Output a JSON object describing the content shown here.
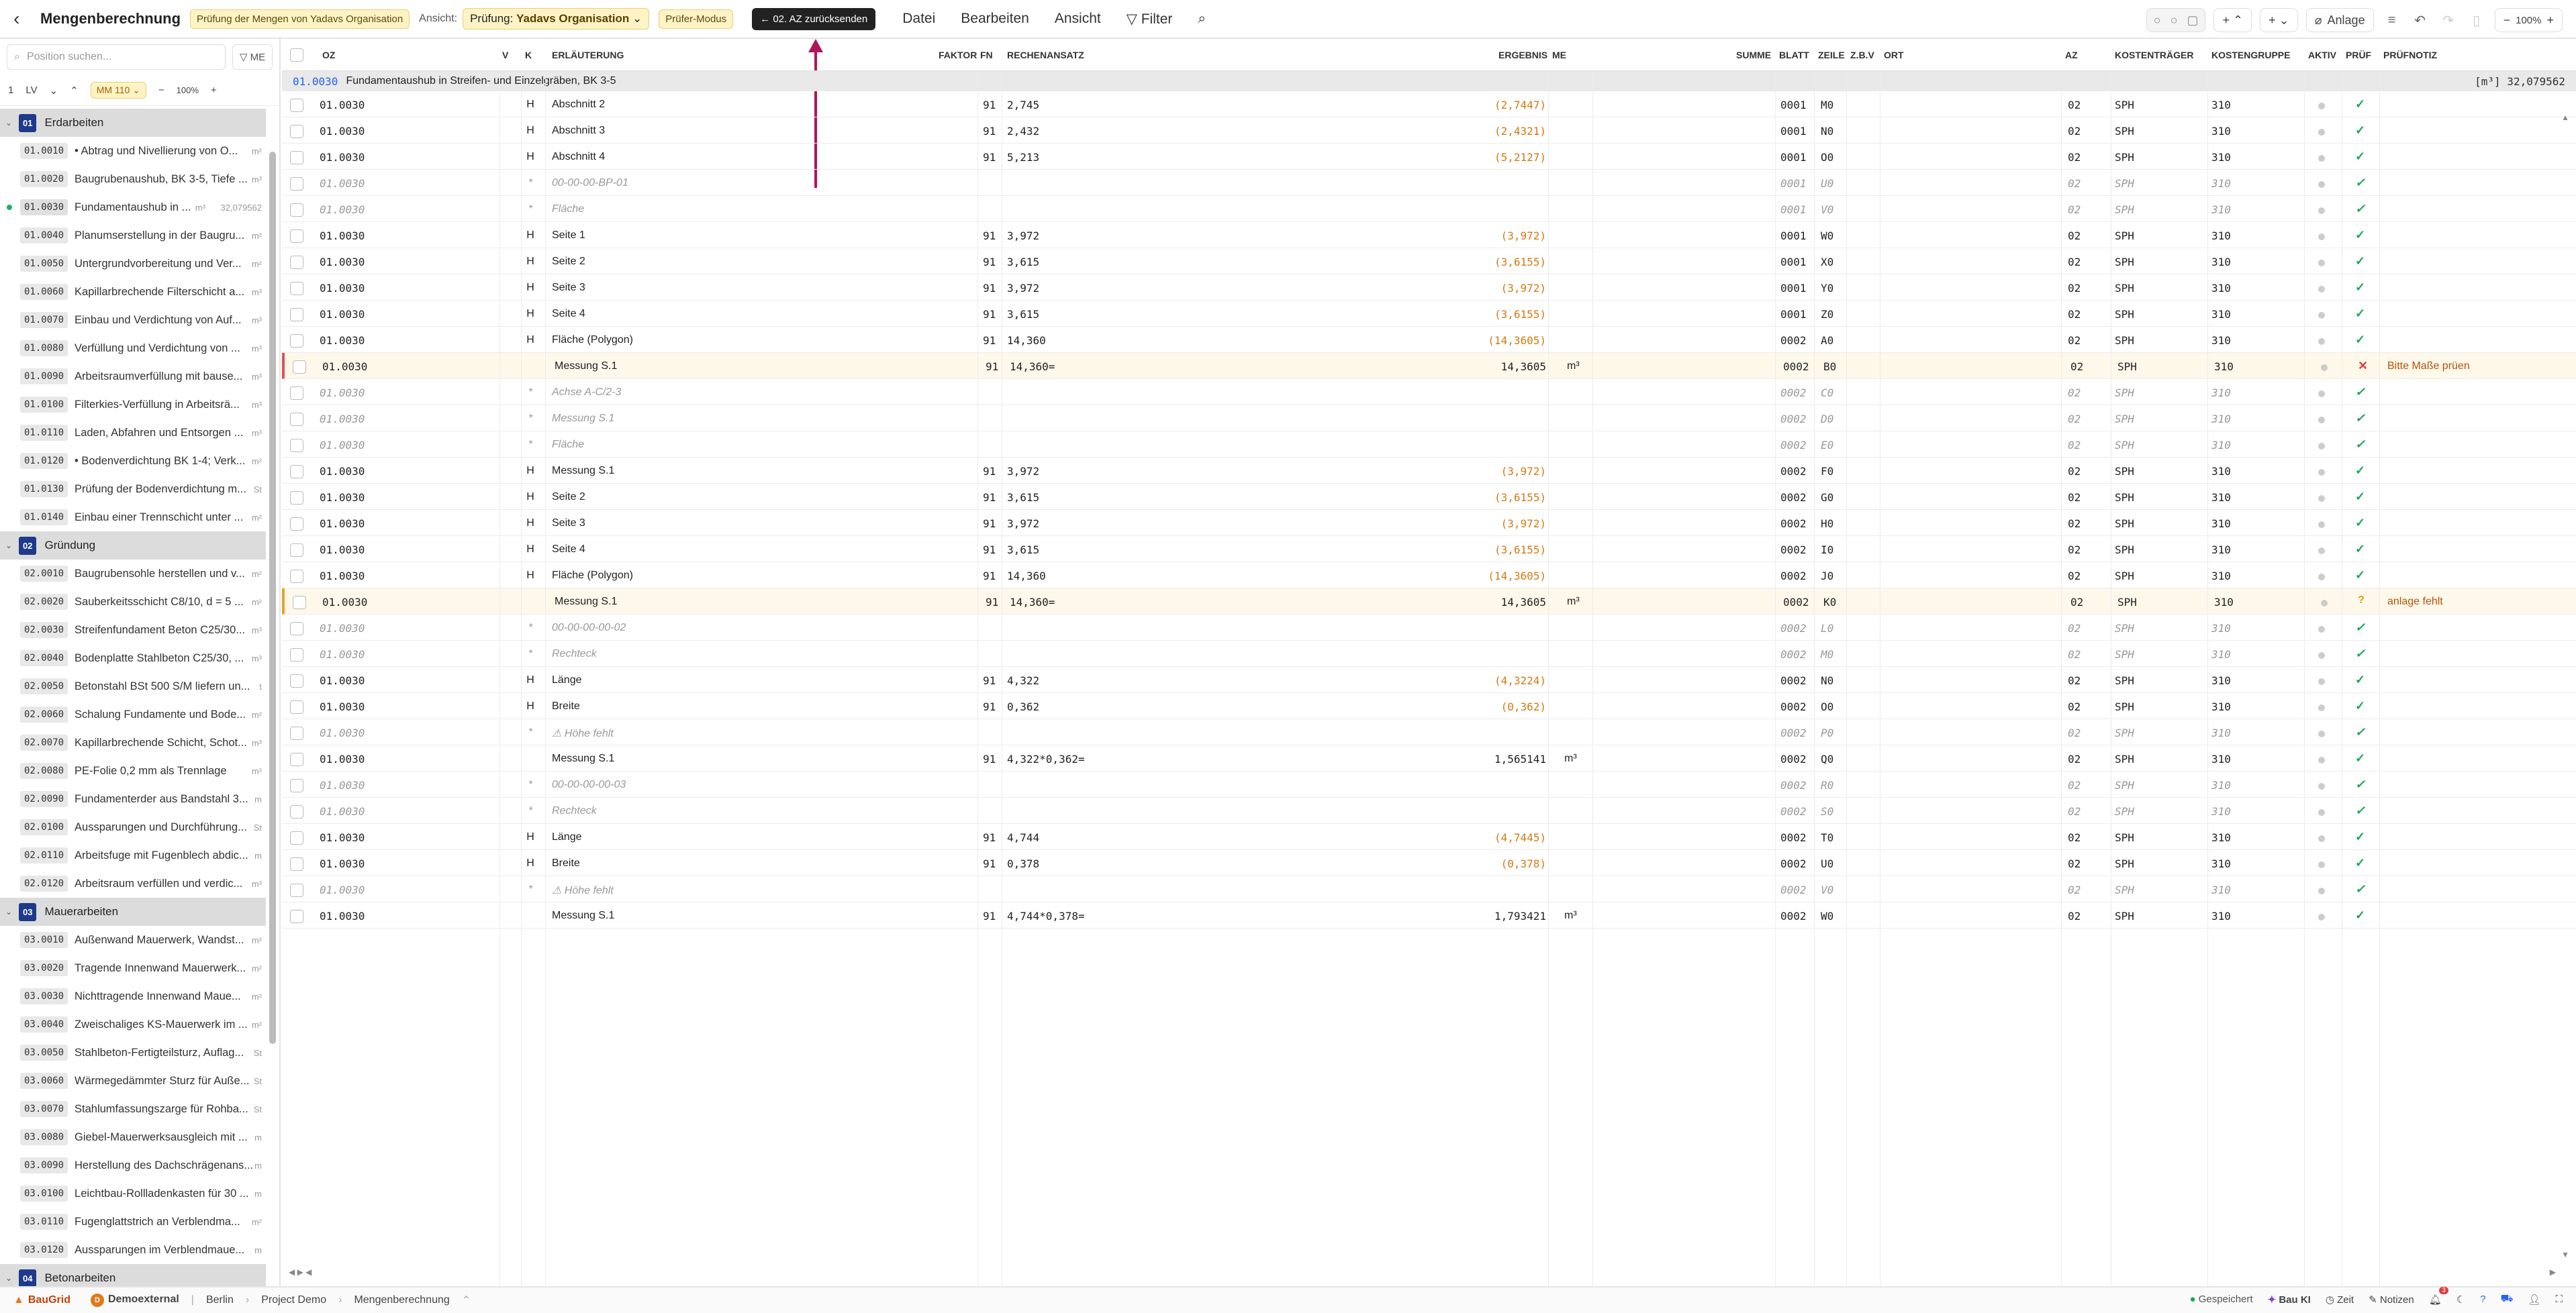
{
  "topbar": {
    "title": "Mengenberechnung",
    "review_badge": "Prüfung der Mengen von Yadavs Organisation",
    "view_label": "Ansicht:",
    "view_prefix": "Prüfung:",
    "view_value": "Yadavs Organisation",
    "mode_badge": "Prüfer-Modus",
    "send_back_button": "02. AZ zurücksenden",
    "menu": [
      "Datei",
      "Bearbeiten",
      "Ansicht"
    ],
    "filter": "Filter",
    "attachment": "Anlage",
    "zoom": "100%"
  },
  "sidebar": {
    "search_placeholder": "Position suchen...",
    "me_button": "ME",
    "level": "1",
    "lv": "LV",
    "mm_badge": "MM 110",
    "zoom": "100%",
    "groups": [
      {
        "num": "01",
        "title": "Erdarbeiten",
        "items": [
          {
            "oz": "01.0010",
            "text": "• Abtrag und Nivellierung von O...",
            "unit": "m²"
          },
          {
            "oz": "01.0020",
            "text": "Baugrubenaushub, BK 3-5, Tiefe ...",
            "unit": "m³"
          },
          {
            "oz": "01.0030",
            "text": "Fundamentaushub in ...",
            "unit": "m³",
            "sum": "32,079562",
            "active": true
          },
          {
            "oz": "01.0040",
            "text": "Planumserstellung in der Baugru...",
            "unit": "m²"
          },
          {
            "oz": "01.0050",
            "text": "Untergrundvorbereitung und Ver...",
            "unit": "m²"
          },
          {
            "oz": "01.0060",
            "text": "Kapillarbrechende Filterschicht a...",
            "unit": "m³"
          },
          {
            "oz": "01.0070",
            "text": "Einbau und Verdichtung von Auf...",
            "unit": "m³"
          },
          {
            "oz": "01.0080",
            "text": "Verfüllung und Verdichtung von ...",
            "unit": "m³"
          },
          {
            "oz": "01.0090",
            "text": "Arbeitsraumverfüllung mit bause...",
            "unit": "m³"
          },
          {
            "oz": "01.0100",
            "text": "Filterkies-Verfüllung in Arbeitsrä...",
            "unit": "m³"
          },
          {
            "oz": "01.0110",
            "text": "Laden, Abfahren und Entsorgen ...",
            "unit": "m³"
          },
          {
            "oz": "01.0120",
            "text": "• Bodenverdichtung BK 1-4; Verk...",
            "unit": "m²"
          },
          {
            "oz": "01.0130",
            "text": "Prüfung der Bodenverdichtung m...",
            "unit": "St"
          },
          {
            "oz": "01.0140",
            "text": "Einbau einer Trennschicht unter ...",
            "unit": "m²"
          }
        ]
      },
      {
        "num": "02",
        "title": "Gründung",
        "items": [
          {
            "oz": "02.0010",
            "text": "Baugrubensohle herstellen und v...",
            "unit": "m²"
          },
          {
            "oz": "02.0020",
            "text": "Sauberkeitsschicht C8/10, d = 5 ...",
            "unit": "m²"
          },
          {
            "oz": "02.0030",
            "text": "Streifenfundament Beton C25/30...",
            "unit": "m³"
          },
          {
            "oz": "02.0040",
            "text": "Bodenplatte Stahlbeton C25/30, ...",
            "unit": "m³"
          },
          {
            "oz": "02.0050",
            "text": "Betonstahl BSt 500 S/M liefern un...",
            "unit": "t"
          },
          {
            "oz": "02.0060",
            "text": "Schalung Fundamente und Bode...",
            "unit": "m²"
          },
          {
            "oz": "02.0070",
            "text": "Kapillarbrechende Schicht, Schot...",
            "unit": "m³"
          },
          {
            "oz": "02.0080",
            "text": "PE-Folie 0,2 mm als Trennlage",
            "unit": "m²"
          },
          {
            "oz": "02.0090",
            "text": "Fundamenterder aus Bandstahl 3...",
            "unit": "m"
          },
          {
            "oz": "02.0100",
            "text": "Aussparungen und Durchführung...",
            "unit": "St"
          },
          {
            "oz": "02.0110",
            "text": "Arbeitsfuge mit Fugenblech abdic...",
            "unit": "m"
          },
          {
            "oz": "02.0120",
            "text": "Arbeitsraum verfüllen und verdic...",
            "unit": "m³"
          }
        ]
      },
      {
        "num": "03",
        "title": "Mauerarbeiten",
        "items": [
          {
            "oz": "03.0010",
            "text": "Außenwand Mauerwerk, Wandst...",
            "unit": "m²"
          },
          {
            "oz": "03.0020",
            "text": "Tragende Innenwand Mauerwerk...",
            "unit": "m²"
          },
          {
            "oz": "03.0030",
            "text": "Nichttragende Innenwand Maue...",
            "unit": "m²"
          },
          {
            "oz": "03.0040",
            "text": "Zweischaliges KS-Mauerwerk im ...",
            "unit": "m²"
          },
          {
            "oz": "03.0050",
            "text": "Stahlbeton-Fertigteilsturz, Auflag...",
            "unit": "St"
          },
          {
            "oz": "03.0060",
            "text": "Wärmegedämmter Sturz für Auße...",
            "unit": "St"
          },
          {
            "oz": "03.0070",
            "text": "Stahlumfassungszarge für Rohba...",
            "unit": "St"
          },
          {
            "oz": "03.0080",
            "text": "Giebel-Mauerwerksausgleich mit ...",
            "unit": "m"
          },
          {
            "oz": "03.0090",
            "text": "Herstellung des Dachschrägenans...",
            "unit": "m"
          },
          {
            "oz": "03.0100",
            "text": "Leichtbau-Rollladenkasten für 30 ...",
            "unit": "m"
          },
          {
            "oz": "03.0110",
            "text": "Fugenglattstrich an Verblendma...",
            "unit": "m²"
          },
          {
            "oz": "03.0120",
            "text": "Aussparungen im Verblendmaue...",
            "unit": "m"
          }
        ]
      },
      {
        "num": "04",
        "title": "Betonarbeiten",
        "items": []
      }
    ]
  },
  "grid": {
    "headers": {
      "oz": "OZ",
      "v": "V",
      "k": "K",
      "erl": "ERLÄUTERUNG",
      "faktor": "FAKTOR",
      "fn": "FN",
      "rechen": "RECHENANSATZ",
      "ergebnis": "ERGEBNIS",
      "me": "ME",
      "summe": "SUMME",
      "blatt": "BLATT",
      "zeile": "ZEILE",
      "zbv": "Z.B.V",
      "ort": "ORT",
      "az": "AZ",
      "kt": "KOSTENTRÄGER",
      "kg": "KOSTENGRUPPE",
      "aktiv": "AKTIV",
      "pruef": "PRÜF",
      "notiz": "PRÜFNOTIZ"
    },
    "section": {
      "oz": "01.0030",
      "title": "Fundamentaushub in Streifen- und Einzelgräben, BK 3-5",
      "sum": "[m³] 32,079562"
    },
    "rows": [
      {
        "oz": "01.0030",
        "k": "H",
        "erl": "Abschnitt 2",
        "fn": "91",
        "rechen": "2,745",
        "erg": "(2,7447)",
        "blatt": "0001",
        "zeile": "M0",
        "az": "02",
        "kt": "SPH",
        "kg": "310",
        "pruef": "check"
      },
      {
        "oz": "01.0030",
        "k": "H",
        "erl": "Abschnitt 3",
        "fn": "91",
        "rechen": "2,432",
        "erg": "(2,4321)",
        "blatt": "0001",
        "zeile": "N0",
        "az": "02",
        "kt": "SPH",
        "kg": "310",
        "pruef": "check"
      },
      {
        "oz": "01.0030",
        "k": "H",
        "erl": "Abschnitt 4",
        "fn": "91",
        "rechen": "5,213",
        "erg": "(5,2127)",
        "blatt": "0001",
        "zeile": "O0",
        "az": "02",
        "kt": "SPH",
        "kg": "310",
        "pruef": "check"
      },
      {
        "oz": "01.0030",
        "k": "*",
        "erl": "00-00-00-BP-01",
        "blatt": "0001",
        "zeile": "U0",
        "az": "02",
        "kt": "SPH",
        "kg": "310",
        "pruef": "check",
        "italic": true
      },
      {
        "oz": "01.0030",
        "k": "*",
        "erl": "Fläche",
        "blatt": "0001",
        "zeile": "V0",
        "az": "02",
        "kt": "SPH",
        "kg": "310",
        "pruef": "check",
        "italic": true
      },
      {
        "oz": "01.0030",
        "k": "H",
        "erl": "Seite 1",
        "fn": "91",
        "rechen": "3,972",
        "erg": "(3,972)",
        "blatt": "0001",
        "zeile": "W0",
        "az": "02",
        "kt": "SPH",
        "kg": "310",
        "pruef": "check"
      },
      {
        "oz": "01.0030",
        "k": "H",
        "erl": "Seite 2",
        "fn": "91",
        "rechen": "3,615",
        "erg": "(3,6155)",
        "blatt": "0001",
        "zeile": "X0",
        "az": "02",
        "kt": "SPH",
        "kg": "310",
        "pruef": "check"
      },
      {
        "oz": "01.0030",
        "k": "H",
        "erl": "Seite 3",
        "fn": "91",
        "rechen": "3,972",
        "erg": "(3,972)",
        "blatt": "0001",
        "zeile": "Y0",
        "az": "02",
        "kt": "SPH",
        "kg": "310",
        "pruef": "check"
      },
      {
        "oz": "01.0030",
        "k": "H",
        "erl": "Seite 4",
        "fn": "91",
        "rechen": "3,615",
        "erg": "(3,6155)",
        "blatt": "0001",
        "zeile": "Z0",
        "az": "02",
        "kt": "SPH",
        "kg": "310",
        "pruef": "check"
      },
      {
        "oz": "01.0030",
        "k": "H",
        "erl": "Fläche (Polygon)",
        "fn": "91",
        "rechen": "14,360",
        "erg": "(14,3605)",
        "blatt": "0002",
        "zeile": "A0",
        "az": "02",
        "kt": "SPH",
        "kg": "310",
        "pruef": "check"
      },
      {
        "oz": "01.0030",
        "k": "",
        "erl": "Messung S.1",
        "fn": "91",
        "rechen": "14,360=",
        "erg": "14,3605",
        "me": "m³",
        "blatt": "0002",
        "zeile": "B0",
        "az": "02",
        "kt": "SPH",
        "kg": "310",
        "pruef": "cross",
        "note": "Bitte Maße prüen",
        "flag": "red"
      },
      {
        "oz": "01.0030",
        "k": "*",
        "erl": "Achse A-C/2-3",
        "blatt": "0002",
        "zeile": "C0",
        "az": "02",
        "kt": "SPH",
        "kg": "310",
        "pruef": "check",
        "italic": true
      },
      {
        "oz": "01.0030",
        "k": "*",
        "erl": "Messung S.1",
        "blatt": "0002",
        "zeile": "D0",
        "az": "02",
        "kt": "SPH",
        "kg": "310",
        "pruef": "check",
        "italic": true
      },
      {
        "oz": "01.0030",
        "k": "*",
        "erl": "Fläche",
        "blatt": "0002",
        "zeile": "E0",
        "az": "02",
        "kt": "SPH",
        "kg": "310",
        "pruef": "check",
        "italic": true
      },
      {
        "oz": "01.0030",
        "k": "H",
        "erl": "Messung S.1",
        "fn": "91",
        "rechen": "3,972",
        "erg": "(3,972)",
        "blatt": "0002",
        "zeile": "F0",
        "az": "02",
        "kt": "SPH",
        "kg": "310",
        "pruef": "check"
      },
      {
        "oz": "01.0030",
        "k": "H",
        "erl": "Seite 2",
        "fn": "91",
        "rechen": "3,615",
        "erg": "(3,6155)",
        "blatt": "0002",
        "zeile": "G0",
        "az": "02",
        "kt": "SPH",
        "kg": "310",
        "pruef": "check"
      },
      {
        "oz": "01.0030",
        "k": "H",
        "erl": "Seite 3",
        "fn": "91",
        "rechen": "3,972",
        "erg": "(3,972)",
        "blatt": "0002",
        "zeile": "H0",
        "az": "02",
        "kt": "SPH",
        "kg": "310",
        "pruef": "check"
      },
      {
        "oz": "01.0030",
        "k": "H",
        "erl": "Seite 4",
        "fn": "91",
        "rechen": "3,615",
        "erg": "(3,6155)",
        "blatt": "0002",
        "zeile": "I0",
        "az": "02",
        "kt": "SPH",
        "kg": "310",
        "pruef": "check"
      },
      {
        "oz": "01.0030",
        "k": "H",
        "erl": "Fläche (Polygon)",
        "fn": "91",
        "rechen": "14,360",
        "erg": "(14,3605)",
        "blatt": "0002",
        "zeile": "J0",
        "az": "02",
        "kt": "SPH",
        "kg": "310",
        "pruef": "check"
      },
      {
        "oz": "01.0030",
        "k": "",
        "erl": "Messung S.1",
        "fn": "91",
        "rechen": "14,360=",
        "erg": "14,3605",
        "me": "m³",
        "blatt": "0002",
        "zeile": "K0",
        "az": "02",
        "kt": "SPH",
        "kg": "310",
        "pruef": "ques",
        "note": "anlage fehlt",
        "flag": "amber"
      },
      {
        "oz": "01.0030",
        "k": "*",
        "erl": "00-00-00-00-02",
        "blatt": "0002",
        "zeile": "L0",
        "az": "02",
        "kt": "SPH",
        "kg": "310",
        "pruef": "check",
        "italic": true
      },
      {
        "oz": "01.0030",
        "k": "*",
        "erl": "Rechteck",
        "blatt": "0002",
        "zeile": "M0",
        "az": "02",
        "kt": "SPH",
        "kg": "310",
        "pruef": "check",
        "italic": true
      },
      {
        "oz": "01.0030",
        "k": "H",
        "erl": "Länge",
        "fn": "91",
        "rechen": "4,322",
        "erg": "(4,3224)",
        "blatt": "0002",
        "zeile": "N0",
        "az": "02",
        "kt": "SPH",
        "kg": "310",
        "pruef": "check"
      },
      {
        "oz": "01.0030",
        "k": "H",
        "erl": "Breite",
        "fn": "91",
        "rechen": "0,362",
        "erg": "(0,362)",
        "blatt": "0002",
        "zeile": "O0",
        "az": "02",
        "kt": "SPH",
        "kg": "310",
        "pruef": "check"
      },
      {
        "oz": "01.0030",
        "k": "*",
        "erl": "⚠ Höhe fehlt",
        "blatt": "0002",
        "zeile": "P0",
        "az": "02",
        "kt": "SPH",
        "kg": "310",
        "pruef": "check",
        "italic": true
      },
      {
        "oz": "01.0030",
        "k": "",
        "erl": "Messung S.1",
        "fn": "91",
        "rechen": "4,322*0,362=",
        "erg": "1,565141",
        "me": "m³",
        "blatt": "0002",
        "zeile": "Q0",
        "az": "02",
        "kt": "SPH",
        "kg": "310",
        "pruef": "check"
      },
      {
        "oz": "01.0030",
        "k": "*",
        "erl": "00-00-00-00-03",
        "blatt": "0002",
        "zeile": "R0",
        "az": "02",
        "kt": "SPH",
        "kg": "310",
        "pruef": "check",
        "italic": true
      },
      {
        "oz": "01.0030",
        "k": "*",
        "erl": "Rechteck",
        "blatt": "0002",
        "zeile": "S0",
        "az": "02",
        "kt": "SPH",
        "kg": "310",
        "pruef": "check",
        "italic": true
      },
      {
        "oz": "01.0030",
        "k": "H",
        "erl": "Länge",
        "fn": "91",
        "rechen": "4,744",
        "erg": "(4,7445)",
        "blatt": "0002",
        "zeile": "T0",
        "az": "02",
        "kt": "SPH",
        "kg": "310",
        "pruef": "check"
      },
      {
        "oz": "01.0030",
        "k": "H",
        "erl": "Breite",
        "fn": "91",
        "rechen": "0,378",
        "erg": "(0,378)",
        "blatt": "0002",
        "zeile": "U0",
        "az": "02",
        "kt": "SPH",
        "kg": "310",
        "pruef": "check"
      },
      {
        "oz": "01.0030",
        "k": "*",
        "erl": "⚠ Höhe fehlt",
        "blatt": "0002",
        "zeile": "V0",
        "az": "02",
        "kt": "SPH",
        "kg": "310",
        "pruef": "check",
        "italic": true
      },
      {
        "oz": "01.0030",
        "k": "",
        "erl": "Messung S.1",
        "fn": "91",
        "rechen": "4,744*0,378=",
        "erg": "1,793421",
        "me": "m³",
        "blatt": "0002",
        "zeile": "W0",
        "az": "02",
        "kt": "SPH",
        "kg": "310",
        "pruef": "check"
      }
    ]
  },
  "footer": {
    "brand": "BauGrid",
    "org": "Demoexternal",
    "breadcrumb": [
      "Berlin",
      "Project Demo",
      "Mengenberechnung"
    ],
    "saved": "Gespeichert",
    "ai": "Bau KI",
    "time": "Zeit",
    "notes": "Notizen",
    "notif_count": "3"
  },
  "colors": {
    "accent_navy": "#1e3a8a",
    "amber_badge": "#fdf3c4",
    "ok_green": "#1aa55a",
    "error_red": "#e03c3c",
    "warn_amber": "#d9a100",
    "value_orange": "#d27a12",
    "arrow": "#b0145a"
  }
}
